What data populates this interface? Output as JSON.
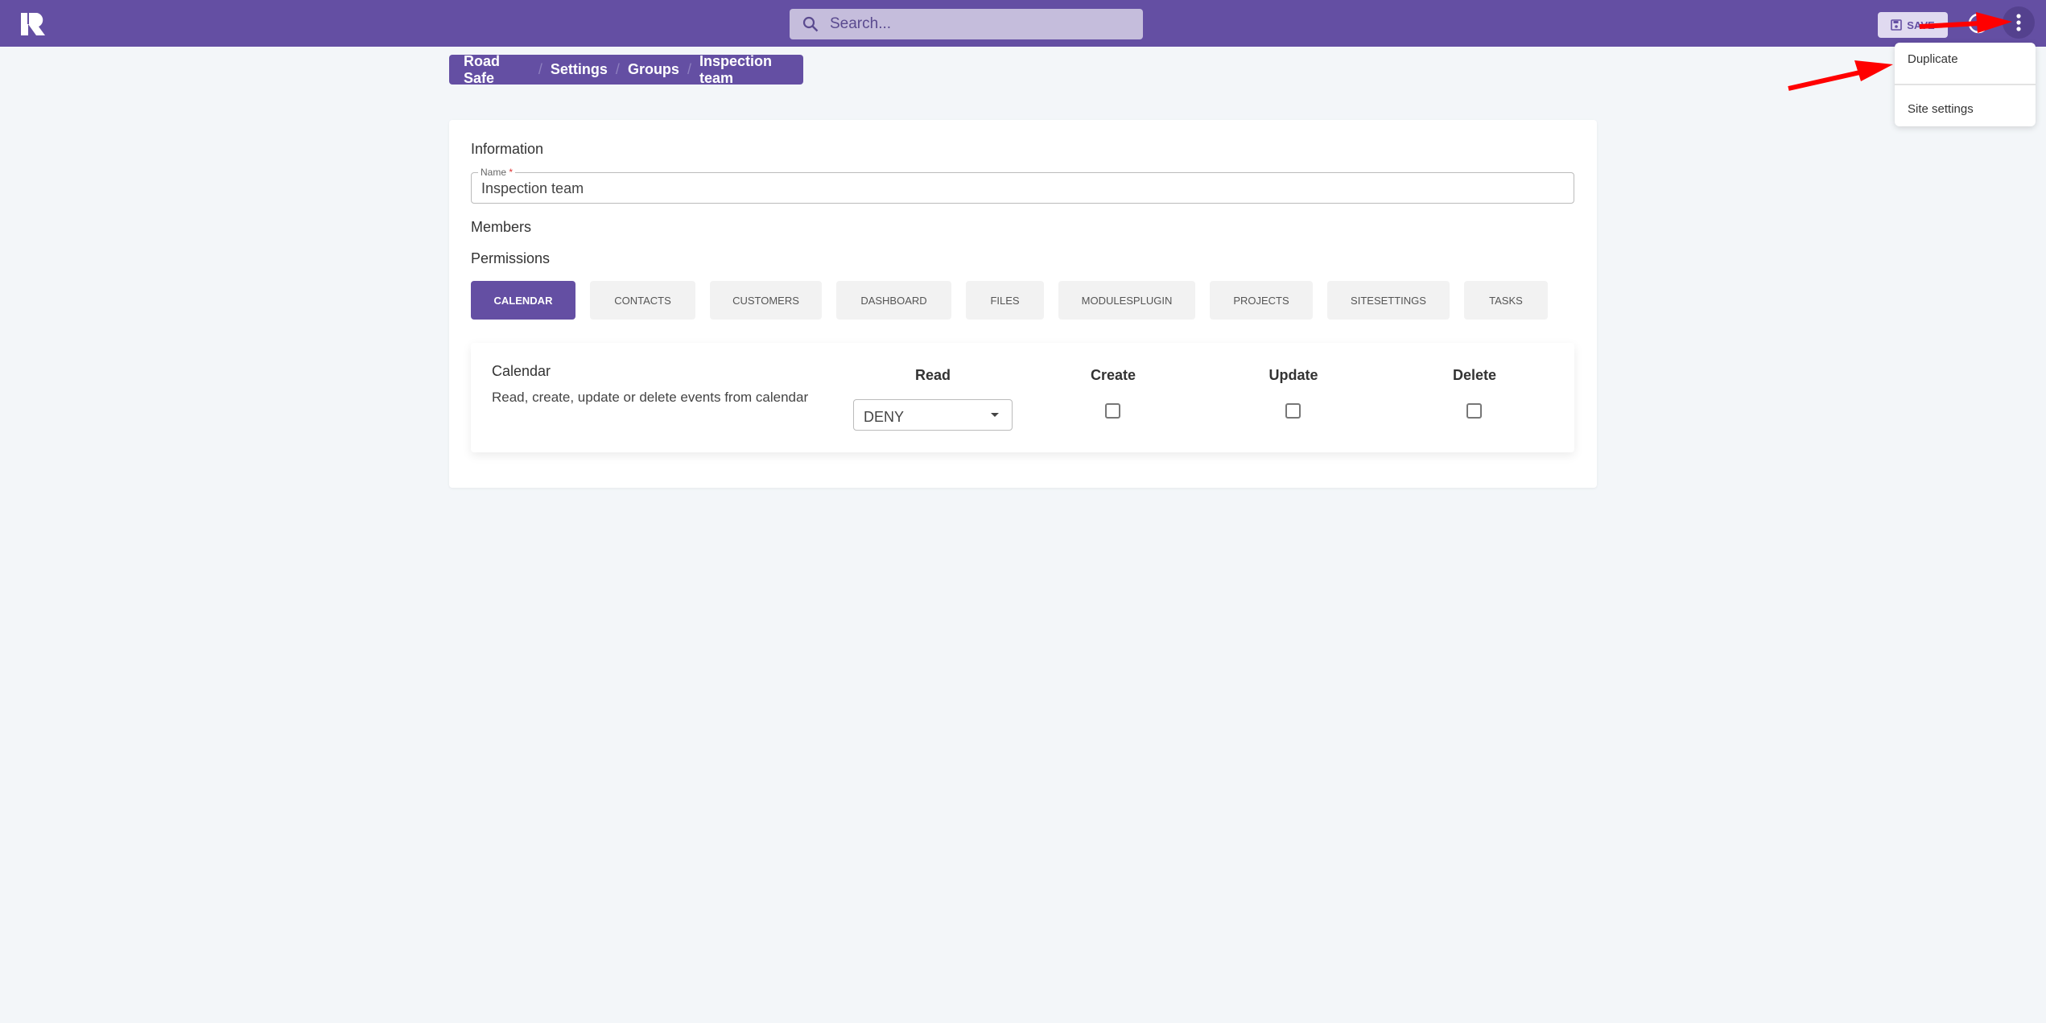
{
  "topbar": {
    "search_placeholder": "Search...",
    "save_label": "SAVE",
    "colors": {
      "brand": "#644fa3"
    }
  },
  "menu": {
    "items": [
      {
        "label": "Duplicate"
      },
      {
        "label": "Site settings"
      }
    ]
  },
  "breadcrumb": [
    "Road Safe",
    "Settings",
    "Groups",
    "Inspection team"
  ],
  "form": {
    "information_heading": "Information",
    "name_label": "Name",
    "name_required": "*",
    "name_value": "Inspection team",
    "members_heading": "Members",
    "permissions_heading": "Permissions",
    "tabs": [
      {
        "label": "CALENDAR",
        "active": true
      },
      {
        "label": "CONTACTS"
      },
      {
        "label": "CUSTOMERS"
      },
      {
        "label": "DASHBOARD"
      },
      {
        "label": "FILES"
      },
      {
        "label": "MODULESPLUGIN"
      },
      {
        "label": "PROJECTS"
      },
      {
        "label": "SITESETTINGS"
      },
      {
        "label": "TASKS"
      }
    ],
    "permission": {
      "title": "Calendar",
      "description": "Read, create, update or delete events from calendar",
      "columns": [
        "Read",
        "Create",
        "Update",
        "Delete"
      ],
      "read_value": "DENY",
      "create": false,
      "update": false,
      "delete": false
    }
  }
}
